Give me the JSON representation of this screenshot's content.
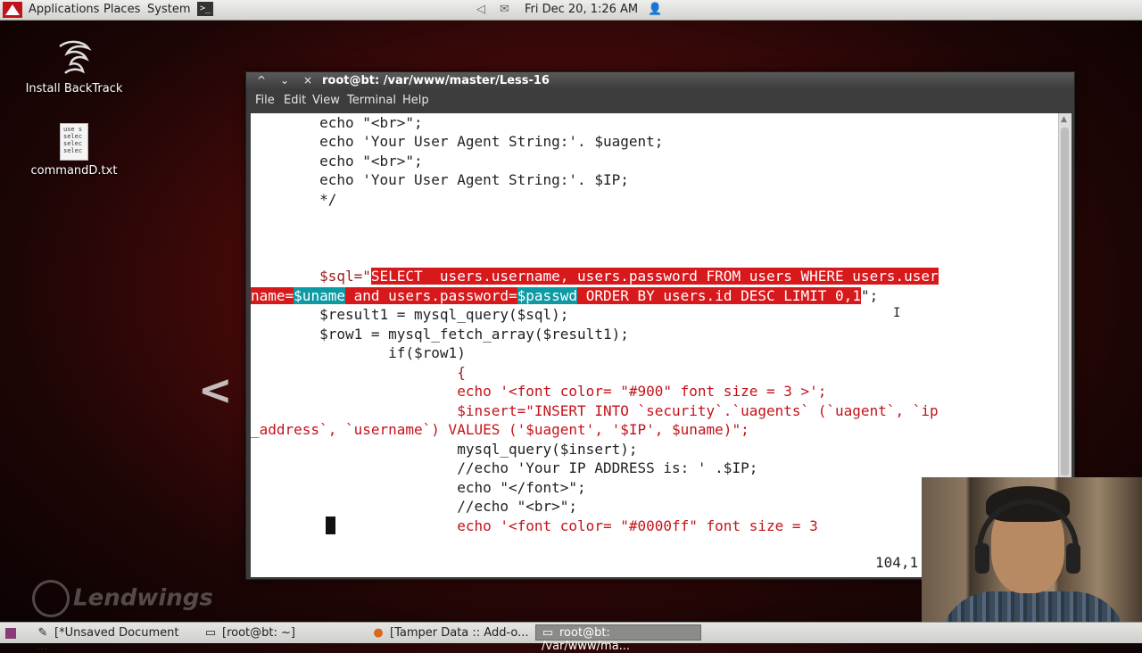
{
  "top_panel": {
    "menus": [
      "Applications",
      "Places",
      "System"
    ],
    "datetime": "Fri Dec 20,  1:26 AM",
    "icons": [
      "backtrack-logo",
      "terminal-launcher-icon",
      "volume-icon",
      "mail-icon",
      "user-icon"
    ]
  },
  "desktop": {
    "icons": [
      {
        "label": "Install BackTrack",
        "icon": "dragon-icon"
      },
      {
        "label": "commandD.txt",
        "icon": "text-file-icon",
        "preview": "use s\nselec\nselec\nselec"
      }
    ]
  },
  "window": {
    "title": "root@bt: /var/www/master/Less-16",
    "controls": [
      "^",
      "⌄",
      "×"
    ],
    "menu": [
      "File",
      "Edit",
      "View",
      "Terminal",
      "Help"
    ]
  },
  "editor": {
    "lines": [
      "        echo \"<br>\";",
      "        echo 'Your User Agent String:'. $uagent;",
      "        echo \"<br>\";",
      "        echo 'Your User Agent String:'. $IP;",
      "        */",
      "",
      "",
      "        $sql=\"",
      "SELECT  users.username, users.password FROM users WHERE users.user",
      "name=",
      "$uname",
      " and users.password=",
      "$passwd",
      " ORDER BY users.id DESC LIMIT 0,1",
      "\";",
      "        $result1 = mysql_query($sql);",
      "        $row1 = mysql_fetch_array($result1);",
      "                if($row1)",
      "                        {",
      "                        echo '<font color= \"#900\" font size = 3 >';",
      "                        $insert=\"INSERT INTO `security`.`uagents` (`uagent`, `ip",
      "_address`, `username`) VALUES ('$uagent', '$IP', $uname)\";",
      "                        mysql_query($insert);",
      "                        //echo 'Your IP ADDRESS is: ' .$IP;",
      "                        echo \"</font>\";",
      "                        //echo \"<br>\";",
      "                        echo '<font color= \"#0000ff\" font size = 3"
    ],
    "status_position": "104,1"
  },
  "taskbar": {
    "tasks": [
      {
        "label": "[*Unsaved Document ...",
        "icon": "text-editor-icon",
        "active": false
      },
      {
        "label": "[root@bt: ~]",
        "icon": "terminal-icon",
        "active": false
      },
      {
        "label": "[Tamper Data :: Add-o...",
        "icon": "firefox-icon",
        "active": false
      },
      {
        "label": "root@bt: /var/www/ma...",
        "icon": "terminal-icon",
        "active": true
      }
    ]
  },
  "watermark": {
    "text": "Lendwings"
  }
}
